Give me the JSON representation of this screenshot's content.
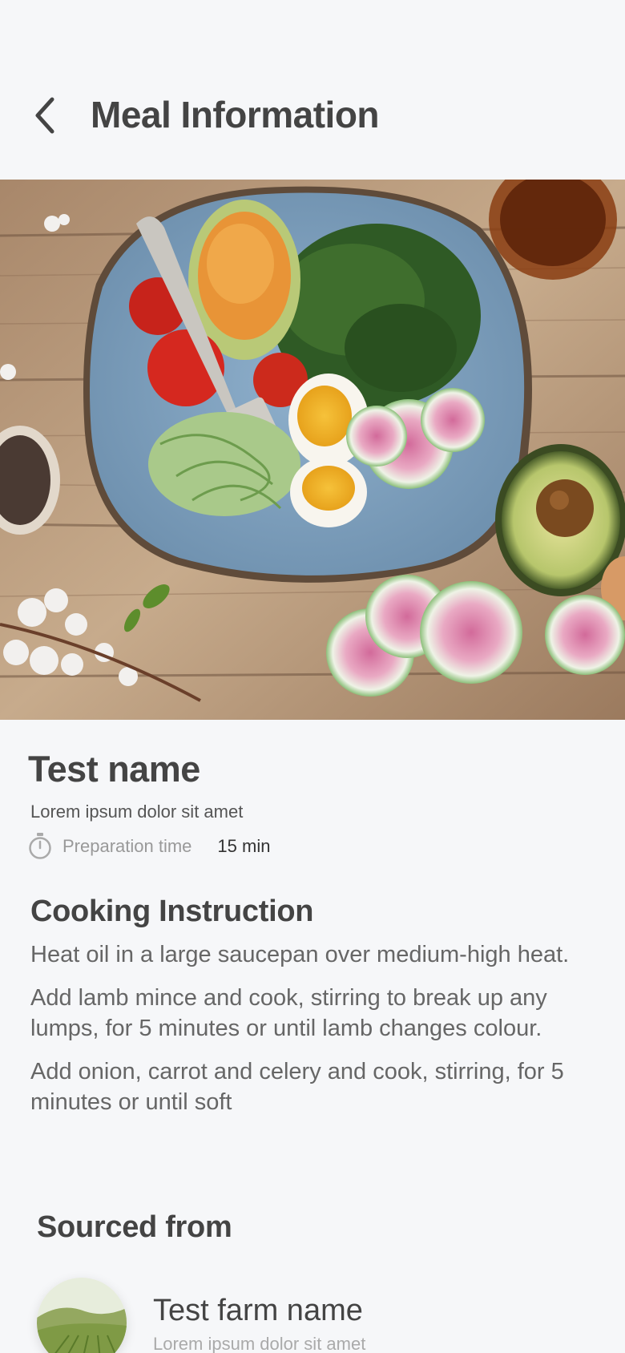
{
  "header": {
    "title": "Meal Information",
    "back_icon": "chevron-left-icon"
  },
  "hero": {
    "image_description_icon": "meal-photo"
  },
  "meal": {
    "name": "Test name",
    "description": "Lorem ipsum dolor sit amet",
    "prep_icon": "stopwatch-icon",
    "prep_label": "Preparation time",
    "prep_value": "15 min"
  },
  "instructions": {
    "title": "Cooking Instruction",
    "steps": [
      "Heat oil in a large saucepan over medium-high heat.",
      "Add lamb mince and cook, stirring to break up any lumps, for 5 minutes or until lamb changes colour.",
      "Add onion, carrot and celery and cook, stirring, for 5 minutes or until soft"
    ]
  },
  "sourced": {
    "title": "Sourced from",
    "farm_name": "Test farm name",
    "farm_desc": "Lorem ipsum dolor sit amet"
  },
  "colors": {
    "background": "#f6f7f9",
    "text_primary": "#444444",
    "text_secondary": "#666666",
    "text_muted": "#999999"
  }
}
